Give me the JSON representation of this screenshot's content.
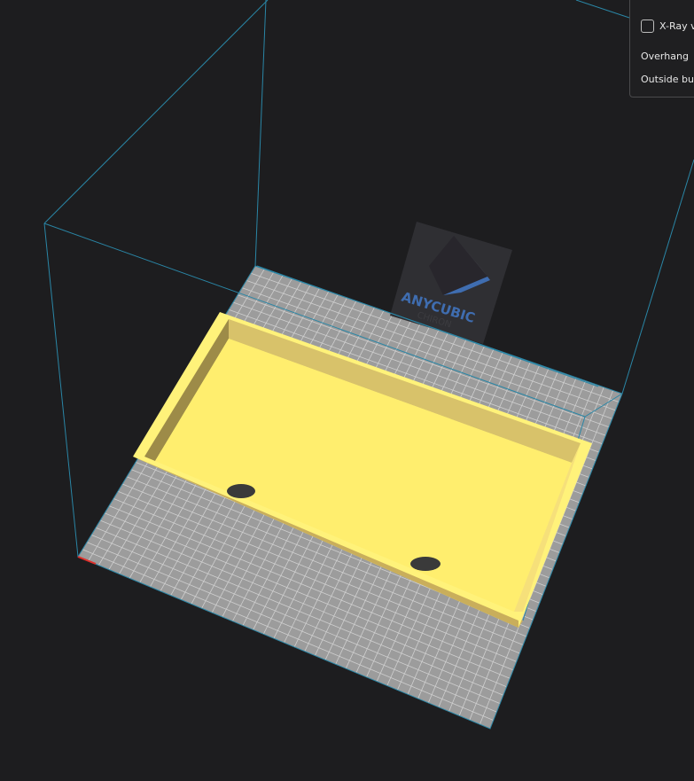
{
  "viewport": {
    "plate_brand": "ANYCUBIC",
    "plate_model": "CHIRON",
    "colors": {
      "background": "#1d1d1f",
      "plate": "#9e9e9e",
      "grid": "#c8c8c8",
      "volume_edge": "#2a86a6",
      "model": "#ffee6e",
      "model_wall": "#d9c064",
      "logo_accent": "#3f6db0"
    }
  },
  "view_panel": {
    "xray_label": "X-Ray v",
    "xray_checked": false,
    "legend": [
      "Overhang",
      "Outside bui"
    ]
  }
}
